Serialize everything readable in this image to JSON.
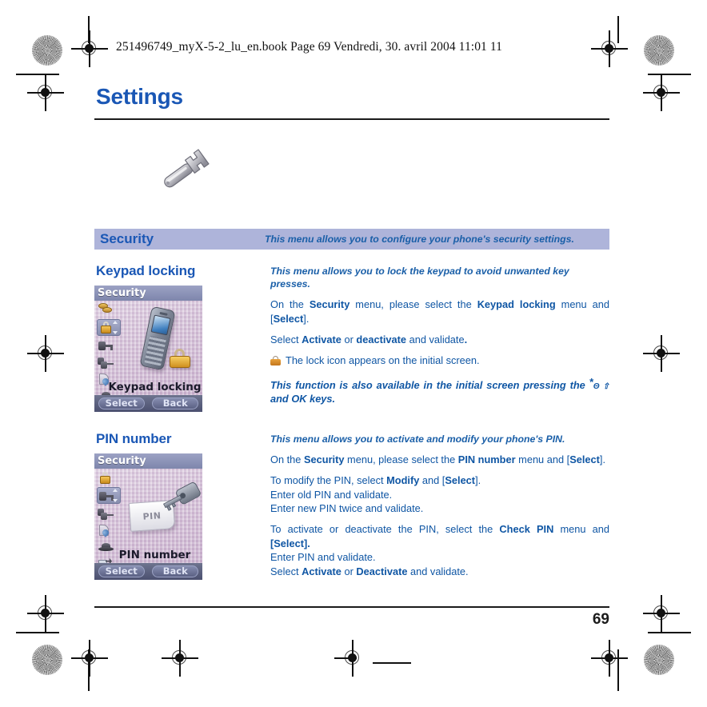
{
  "slug": "251496749_myX-5-2_lu_en.book  Page 69  Vendredi, 30. avril 2004  11:01 11",
  "chapter": {
    "title": "Settings",
    "icon": "wrench-icon"
  },
  "banner": {
    "name": "Security",
    "description": "This menu allows you to configure your phone's security settings."
  },
  "sections": [
    {
      "heading": "Keypad locking",
      "lead": "This menu allows you to lock the keypad to avoid unwanted key presses.",
      "paragraphs": [
        {
          "runs": [
            {
              "t": "On the ",
              "b": false
            },
            {
              "t": "Security",
              "b": true
            },
            {
              "t": " menu, please select the ",
              "b": false
            },
            {
              "t": "Keypad locking",
              "b": true
            },
            {
              "t": " menu and [",
              "b": false
            },
            {
              "t": "Select",
              "b": true
            },
            {
              "t": "].",
              "b": false
            }
          ]
        },
        {
          "runs": [
            {
              "t": "Select ",
              "b": false
            },
            {
              "t": "Activate",
              "b": true
            },
            {
              "t": " or ",
              "b": false
            },
            {
              "t": "deactivate",
              "b": true
            },
            {
              "t": " and validate",
              "b": false
            },
            {
              "t": ".",
              "b": true
            }
          ]
        }
      ],
      "note": {
        "icon": "padlock-icon",
        "text": "The lock icon appears on the initial screen."
      },
      "italic_note": {
        "text_before": "This function is also available in the initial screen pressing the",
        "key_symbol": "*",
        "key_sub": "Θ ⇧",
        "text_after_prefix": "and ",
        "text_after_bold": "OK",
        "text_after_suffix": " keys."
      },
      "phone": {
        "title": "Security",
        "label": "Keypad locking",
        "softkeys": [
          "Select",
          "Back"
        ],
        "artwork": "phone-with-padlock",
        "menu_icons": [
          "coins-icon",
          "padlock-icon-selected",
          "key-icon",
          "two-keys-icon",
          "blood-drop-icon",
          "stamp-icon"
        ]
      }
    },
    {
      "heading": "PIN number",
      "lead": "This menu allows you to activate and modify your phone's PIN.",
      "paragraphs": [
        {
          "runs": [
            {
              "t": "On the ",
              "b": false
            },
            {
              "t": "Security",
              "b": true
            },
            {
              "t": " menu, please select the ",
              "b": false
            },
            {
              "t": "PIN number",
              "b": true
            },
            {
              "t": " menu and [",
              "b": false
            },
            {
              "t": "Select",
              "b": true
            },
            {
              "t": "].",
              "b": false
            }
          ]
        },
        {
          "runs": [
            {
              "t": "To modify the PIN, select ",
              "b": false
            },
            {
              "t": "Modify",
              "b": true
            },
            {
              "t": " and [",
              "b": false
            },
            {
              "t": "Select",
              "b": true
            },
            {
              "t": "].",
              "b": false
            },
            {
              "t": "\n",
              "b": false
            },
            {
              "t": "Enter old PIN and validate.",
              "b": false
            },
            {
              "t": "\n",
              "b": false
            },
            {
              "t": "Enter new PIN twice and validate.",
              "b": false
            }
          ]
        },
        {
          "runs": [
            {
              "t": "To activate or deactivate the PIN, select the ",
              "b": false
            },
            {
              "t": "Check PIN",
              "b": true
            },
            {
              "t": " menu and ",
              "b": false
            },
            {
              "t": "[Select].",
              "b": true
            },
            {
              "t": "\n",
              "b": false
            },
            {
              "t": "Enter PIN and validate.",
              "b": false
            },
            {
              "t": "\n",
              "b": false
            },
            {
              "t": "Select ",
              "b": false
            },
            {
              "t": "Activate",
              "b": true
            },
            {
              "t": " or ",
              "b": false
            },
            {
              "t": "Deactivate",
              "b": true
            },
            {
              "t": " and validate.",
              "b": false
            }
          ]
        }
      ],
      "phone": {
        "title": "Security",
        "label": "PIN number",
        "softkeys": [
          "Select",
          "Back"
        ],
        "artwork": "key-with-pin-card",
        "pin_card_text": "PIN",
        "menu_icons": [
          "padlock-icon",
          "key-icon-selected",
          "two-keys-icon",
          "blood-drop-icon",
          "stamp-icon",
          "hand-card-icon"
        ]
      }
    }
  ],
  "footer": {
    "page_number": "69"
  },
  "colors": {
    "heading_blue": "#1a57b5",
    "body_blue": "#0f56a4",
    "banner_bg": "#aeb4da",
    "rule_black": "#1b1b1b"
  }
}
